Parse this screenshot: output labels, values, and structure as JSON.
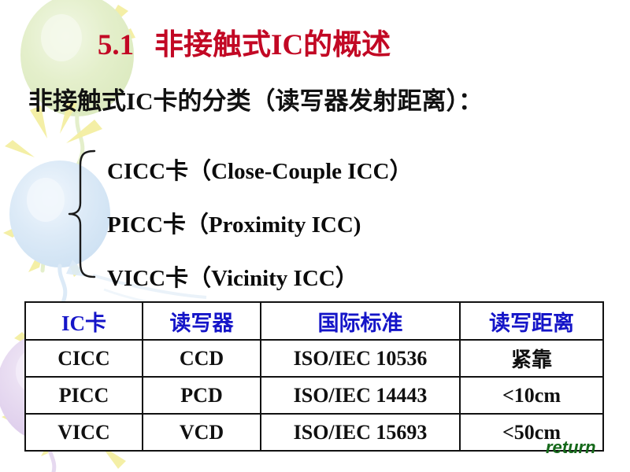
{
  "slide": {
    "title": {
      "number": "5.1",
      "text": "非接触式IC的概述",
      "color": "#C20824"
    },
    "subtitle": "非接触式IC卡的分类（读写器发射距离）：",
    "card_kinds": [
      "CICC卡（Close-Couple ICC）",
      "PICC卡（Proximity ICC)",
      "VICC卡（Vicinity ICC）"
    ],
    "table": {
      "headers": [
        "IC卡",
        "读写器",
        "国际标准",
        "读写距离"
      ],
      "header_color": "#1515C8",
      "rows": [
        [
          "CICC",
          "CCD",
          "ISO/IEC 10536",
          "紧靠"
        ],
        [
          "PICC",
          "PCD",
          "ISO/IEC 14443",
          "<10cm"
        ],
        [
          "VICC",
          "VCD",
          "ISO/IEC 15693",
          "<50cm"
        ]
      ]
    },
    "return_link": {
      "label": "return",
      "color": "#15691A"
    },
    "decorations": {
      "balloon_green": "#E4EFCB",
      "balloon_blue": "#DCEAF7",
      "balloon_purple": "#E6D9F0",
      "ray_yellow": "#F4EFA2"
    }
  }
}
